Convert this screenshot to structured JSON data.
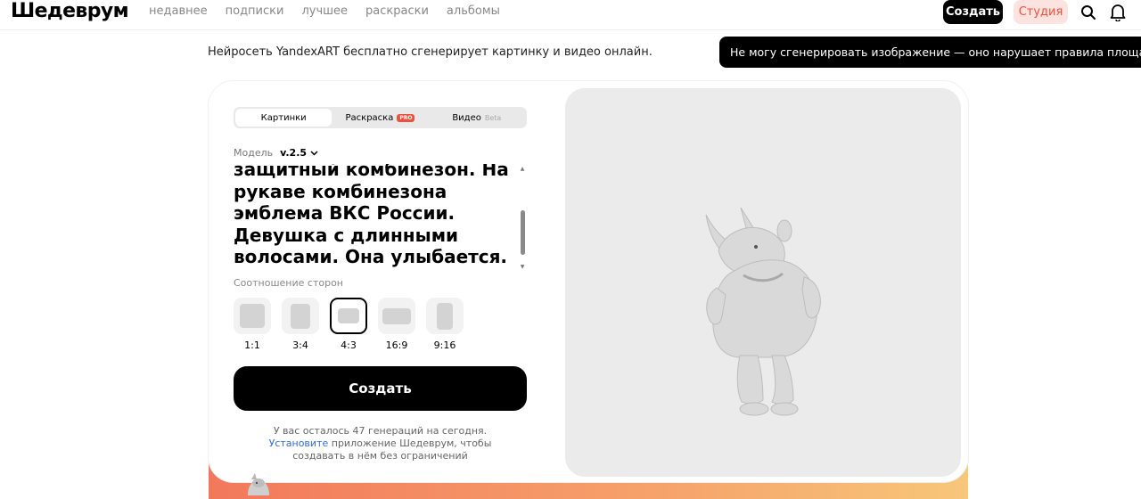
{
  "header": {
    "logo": "Шедеврум",
    "nav": [
      "недавнее",
      "подписки",
      "лучшее",
      "раскраски",
      "альбомы"
    ],
    "create_label": "Создать",
    "studio_label": "Студия"
  },
  "subtitle": "Нейросеть YandexART бесплатно сгенерирует картинку и видео онлайн.",
  "toast": "Не могу сгенерировать изображение — оно нарушает правила площадки",
  "tabs": [
    {
      "label": "Картинки",
      "active": true
    },
    {
      "label": "Раскраска",
      "badge": "PRO"
    },
    {
      "label": "Видео",
      "badge": "Beta"
    }
  ],
  "model": {
    "label": "Модель",
    "value": "v.2.5"
  },
  "prompt": "защитный комбинезон.  На\nрукаве комбинезона\nэмблема ВКС России.\nДевушка с длинными\nволосами. Она  улыбается.",
  "aspect": {
    "label": "Соотношение сторон",
    "options": [
      "1:1",
      "3:4",
      "4:3",
      "16:9",
      "9:16"
    ],
    "selected": "4:3"
  },
  "create_button": "Создать",
  "info": {
    "line1": "У вас осталось 47 генераций на сегодня.",
    "link": "Установите",
    "line2": " приложение Шедеврум, чтобы",
    "line3": "создавать в нём без ограничений"
  },
  "colors": {
    "accent": "#f0503c",
    "link": "#2f6bd9",
    "preview_bg": "#ebebeb"
  }
}
